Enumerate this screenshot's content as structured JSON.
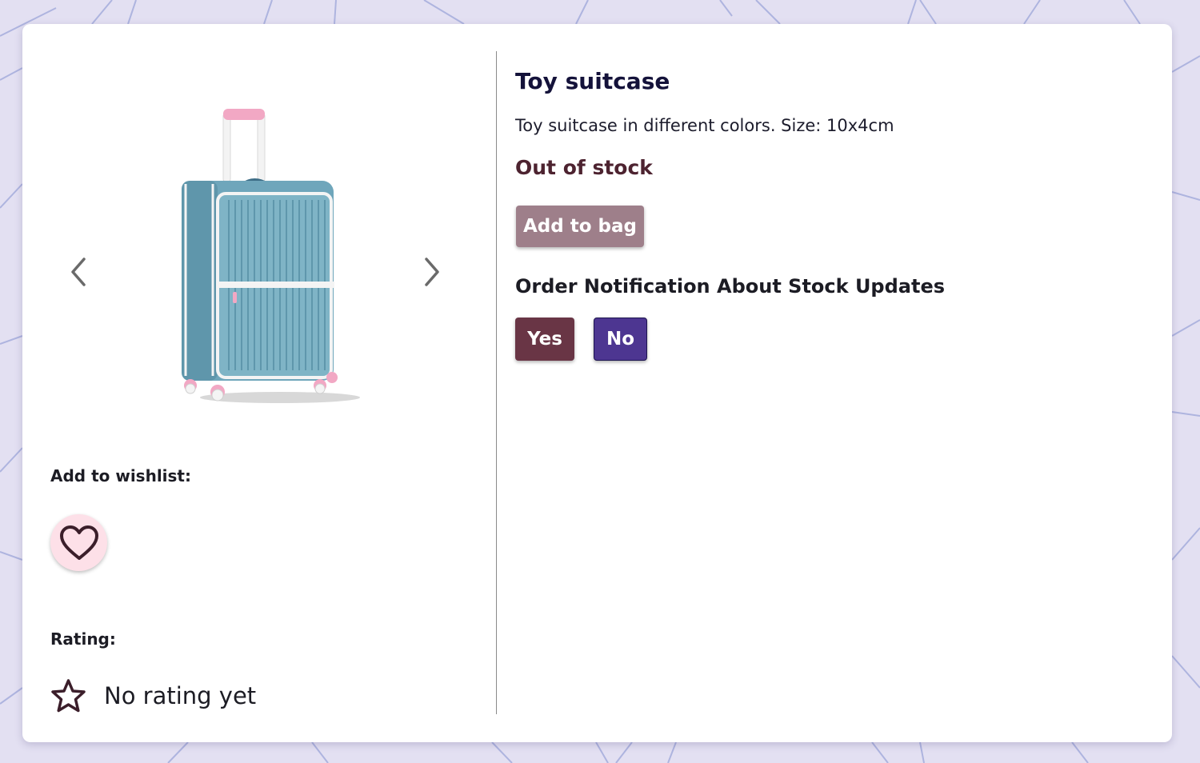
{
  "product": {
    "title": "Toy suitcase",
    "description": "Toy suitcase in different colors. Size: 10x4cm",
    "stock_status": "Out of stock",
    "add_to_bag_label": "Add to bag",
    "image_alt": "Toy suitcase"
  },
  "gallery": {
    "prev_icon": "chevron-left-icon",
    "next_icon": "chevron-right-icon"
  },
  "wishlist": {
    "label": "Add to wishlist:",
    "icon": "heart-icon"
  },
  "rating": {
    "label": "Rating:",
    "text": "No rating yet",
    "icon": "star-icon"
  },
  "notification": {
    "heading": "Order Notification About Stock Updates",
    "yes_label": "Yes",
    "no_label": "No"
  },
  "colors": {
    "background": "#e3e0f2",
    "card": "#ffffff",
    "stock_status": "#4d2330",
    "add_to_bag_disabled": "#9e7f8a",
    "yes_button": "#693545",
    "no_button": "#4d3691",
    "wishlist_button": "#fde0e8"
  }
}
